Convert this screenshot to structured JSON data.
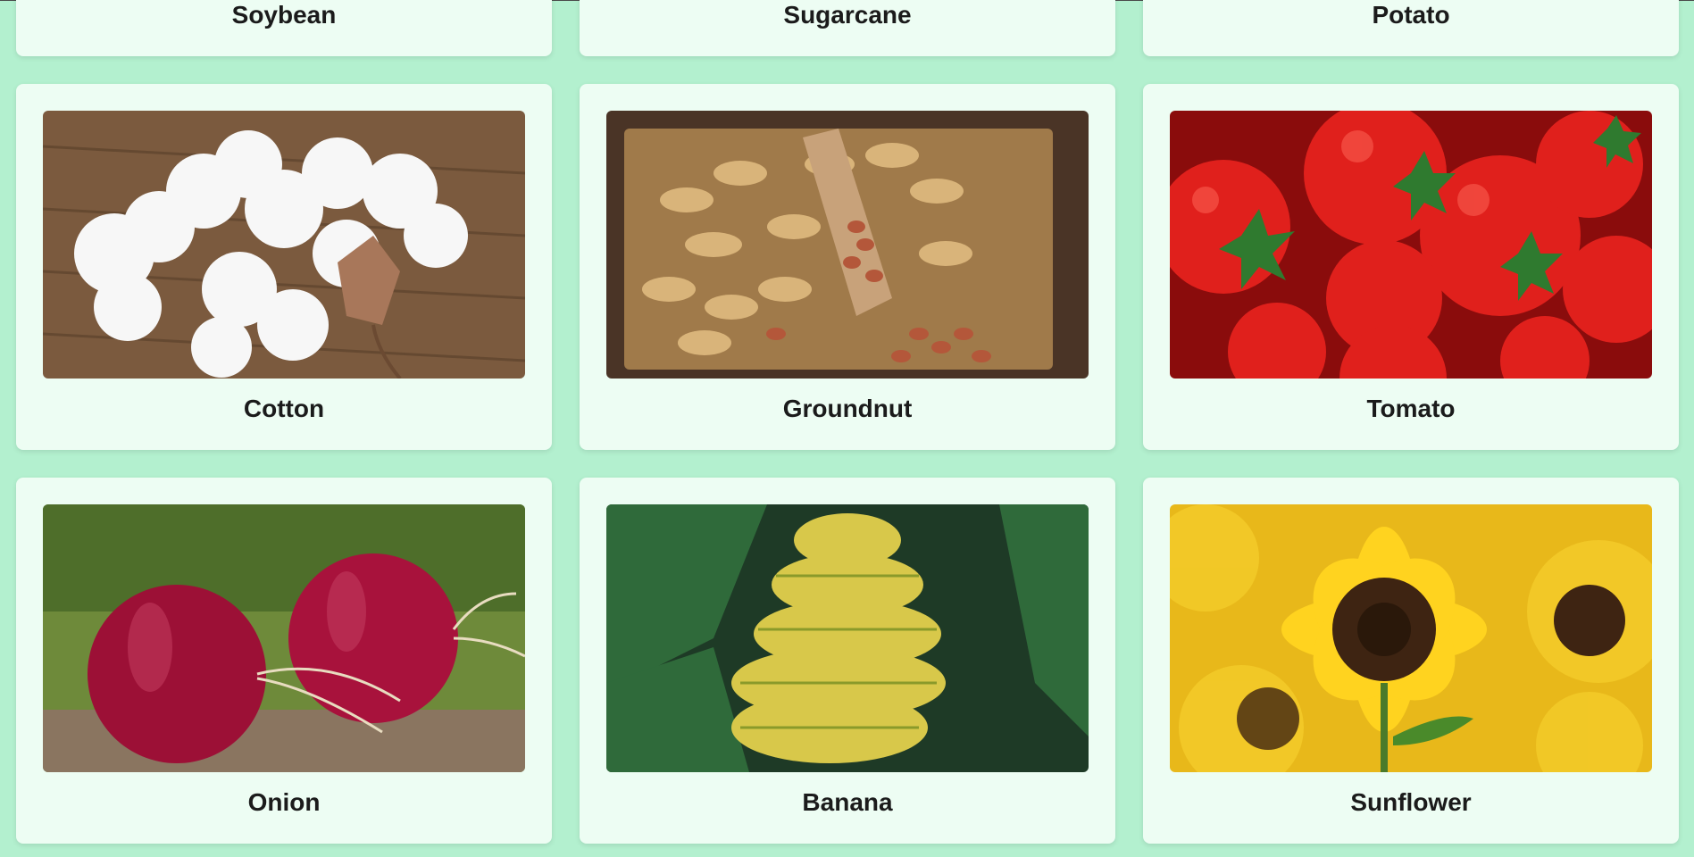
{
  "crops": {
    "top": [
      {
        "name": "Soybean"
      },
      {
        "name": "Sugarcane"
      },
      {
        "name": "Potato"
      }
    ],
    "row2": [
      {
        "name": "Cotton",
        "image_icon": "cotton-image"
      },
      {
        "name": "Groundnut",
        "image_icon": "groundnut-image"
      },
      {
        "name": "Tomato",
        "image_icon": "tomato-image"
      }
    ],
    "row3": [
      {
        "name": "Onion",
        "image_icon": "onion-image"
      },
      {
        "name": "Banana",
        "image_icon": "banana-image"
      },
      {
        "name": "Sunflower",
        "image_icon": "sunflower-image"
      }
    ]
  },
  "colors": {
    "page_bg": "#b3f0cf",
    "card_bg": "#edfdf3"
  }
}
